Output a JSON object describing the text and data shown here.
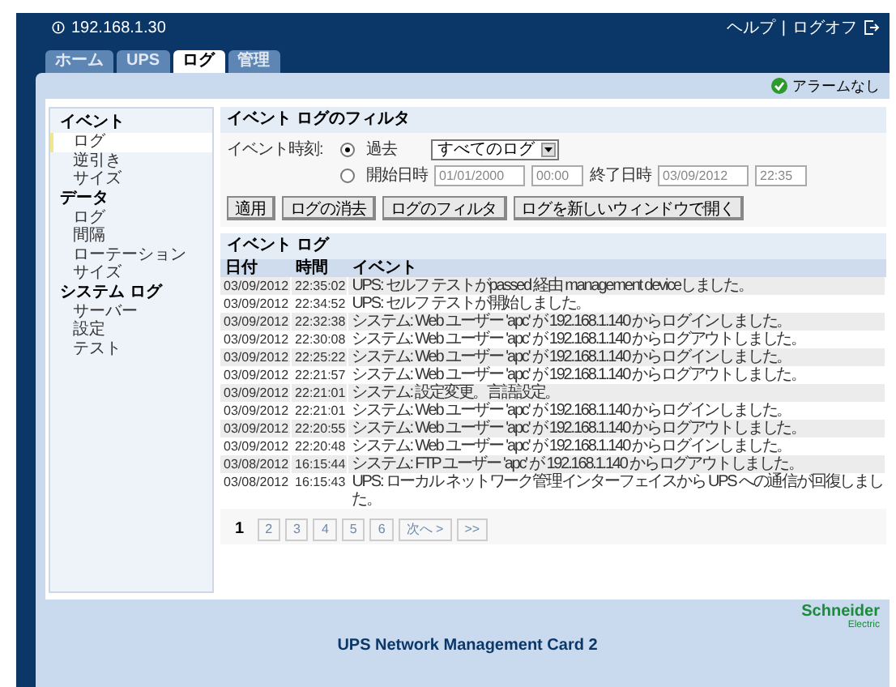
{
  "header": {
    "address": "192.168.1.30",
    "links": [
      "ヘルプ",
      "ログオフ"
    ],
    "separator": "|"
  },
  "tabs": [
    {
      "label": "ホーム",
      "selected": false
    },
    {
      "label": "UPS",
      "selected": false
    },
    {
      "label": "ログ",
      "selected": true
    },
    {
      "label": "管理",
      "selected": false
    }
  ],
  "alarm_status": "アラームなし",
  "sidebar": {
    "items": [
      {
        "label": "イベント",
        "children": [
          {
            "label": "ログ",
            "selected": true
          },
          {
            "label": "逆引き",
            "selected": false
          },
          {
            "label": "サイズ",
            "selected": false
          }
        ]
      },
      {
        "label": "データ",
        "children": [
          {
            "label": "ログ",
            "selected": false
          },
          {
            "label": "間隔",
            "selected": false
          },
          {
            "label": "ローテーション",
            "selected": false
          },
          {
            "label": "サイズ",
            "selected": false
          }
        ]
      },
      {
        "label": "システム ログ",
        "children": [
          {
            "label": "サーバー",
            "selected": false
          },
          {
            "label": "設定",
            "selected": false
          },
          {
            "label": "テスト",
            "selected": false
          }
        ]
      }
    ]
  },
  "filter": {
    "title": "イベント ログのフィルタ",
    "time_label": "イベント時刻:",
    "options": [
      {
        "label": "過去",
        "selected": true
      },
      {
        "label": "開始日時",
        "selected": false
      }
    ],
    "range_select": "すべてのログ",
    "start_date": "01/01/2000",
    "start_time": "00:00",
    "end_label": "終了日時",
    "end_date": "03/09/2012",
    "end_time": "22:35",
    "buttons": [
      "適用",
      "ログの消去",
      "ログのフィルタ",
      "ログを新しいウィンドウで開く"
    ]
  },
  "event_log": {
    "title": "イベント ログ",
    "columns": [
      "日付",
      "時間",
      "イベント"
    ],
    "rows": [
      [
        "03/09/2012",
        "22:35:02",
        "UPS: セルフ テストがpassed 経由 management deviceしました。"
      ],
      [
        "03/09/2012",
        "22:34:52",
        "UPS: セルフ テストが開始しました。"
      ],
      [
        "03/09/2012",
        "22:32:38",
        "システム: Web ユーザー 'apc' が 192.168.1.140 からログインしました。"
      ],
      [
        "03/09/2012",
        "22:30:08",
        "システム: Web ユーザー 'apc' が 192.168.1.140 からログアウトしました。"
      ],
      [
        "03/09/2012",
        "22:25:22",
        "システム: Web ユーザー 'apc' が 192.168.1.140 からログインしました。"
      ],
      [
        "03/09/2012",
        "22:21:57",
        "システム: Web ユーザー 'apc' が 192.168.1.140 からログアウトしました。"
      ],
      [
        "03/09/2012",
        "22:21:01",
        "システム: 設定変更。言語設定。"
      ],
      [
        "03/09/2012",
        "22:21:01",
        "システム: Web ユーザー 'apc' が 192.168.1.140 からログインしました。"
      ],
      [
        "03/09/2012",
        "22:20:55",
        "システム: Web ユーザー 'apc' が 192.168.1.140 からログアウトしました。"
      ],
      [
        "03/09/2012",
        "22:20:48",
        "システム: Web ユーザー 'apc' が 192.168.1.140 からログインしました。"
      ],
      [
        "03/08/2012",
        "16:15:44",
        "システム: FTP ユーザー 'apc' が 192.168.1.140 からログアウトしました。"
      ],
      [
        "03/08/2012",
        "16:15:43",
        "UPS: ローカル ネットワーク管理インターフェイスから UPS への通信が回復しました。"
      ]
    ],
    "pages": [
      {
        "label": "1",
        "selected": true
      },
      {
        "label": "2",
        "selected": false
      },
      {
        "label": "3",
        "selected": false
      },
      {
        "label": "4",
        "selected": false
      },
      {
        "label": "5",
        "selected": false
      },
      {
        "label": "6",
        "selected": false
      },
      {
        "label": "次へ >",
        "selected": false
      },
      {
        "label": ">>",
        "selected": false
      }
    ]
  },
  "footer": {
    "brand": "Schneider",
    "brand_sub": "Electric",
    "product": "UPS Network Management Card 2"
  }
}
